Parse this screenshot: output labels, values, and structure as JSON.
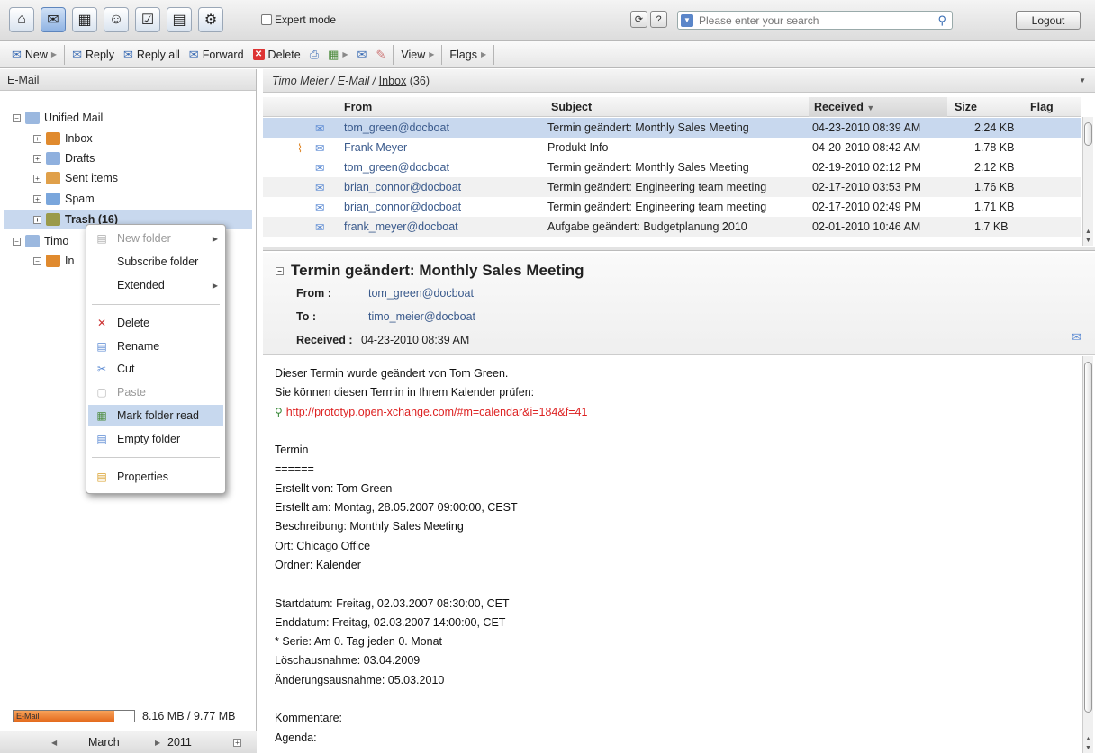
{
  "topbar": {
    "modules": [
      "home-icon",
      "mail-icon",
      "calendar-icon",
      "contacts-icon",
      "tasks-icon",
      "infostore-icon",
      "settings-icon"
    ],
    "expert_mode_label": "Expert mode",
    "search_placeholder": "Please enter your search",
    "logout_label": "Logout"
  },
  "toolbar": {
    "new": "New",
    "reply": "Reply",
    "reply_all": "Reply all",
    "forward": "Forward",
    "delete": "Delete",
    "view": "View",
    "flags": "Flags"
  },
  "left": {
    "header": "E-Mail",
    "tree": {
      "unified_mail": "Unified Mail",
      "inbox": "Inbox",
      "drafts": "Drafts",
      "sent": "Sent items",
      "spam": "Spam",
      "trash": "Trash (16)",
      "timo": "Timo",
      "timo_inbox": "In"
    },
    "quota": {
      "label": "E-Mail",
      "text": "8.16 MB / 9.77 MB",
      "fraction": 0.835
    },
    "calendar": {
      "month": "March",
      "year": "2011"
    }
  },
  "context_menu": {
    "new_folder": "New folder",
    "subscribe_folder": "Subscribe folder",
    "extended": "Extended",
    "delete": "Delete",
    "rename": "Rename",
    "cut": "Cut",
    "paste": "Paste",
    "mark_folder_read": "Mark folder read",
    "empty_folder": "Empty folder",
    "properties": "Properties"
  },
  "breadcrumb": {
    "user": "Timo Meier",
    "section": "E-Mail",
    "folder": "Inbox",
    "count": "(36)"
  },
  "message_list": {
    "headers": {
      "from": "From",
      "subject": "Subject",
      "received": "Received",
      "size": "Size",
      "flag": "Flag"
    },
    "rows": [
      {
        "from": "tom_green@docboat",
        "subject": "Termin geändert: Monthly Sales Meeting",
        "received": "04-23-2010 08:39 AM",
        "size": "2.24 KB"
      },
      {
        "from": "Frank Meyer",
        "subject": "Produkt Info",
        "received": "04-20-2010 08:42 AM",
        "size": "1.78 KB"
      },
      {
        "from": "tom_green@docboat",
        "subject": "Termin geändert: Monthly Sales Meeting",
        "received": "02-19-2010 02:12 PM",
        "size": "2.12 KB"
      },
      {
        "from": "brian_connor@docboat",
        "subject": "Termin geändert: Engineering team meeting",
        "received": "02-17-2010 03:53 PM",
        "size": "1.76 KB"
      },
      {
        "from": "brian_connor@docboat",
        "subject": "Termin geändert: Engineering team meeting",
        "received": "02-17-2010 02:49 PM",
        "size": "1.71 KB"
      },
      {
        "from": "frank_meyer@docboat",
        "subject": "Aufgabe geändert: Budgetplanung 2010",
        "received": "02-01-2010 10:46 AM",
        "size": "1.7 KB"
      }
    ]
  },
  "preview": {
    "subject": "Termin geändert: Monthly Sales Meeting",
    "from_label": "From :",
    "from_value": "tom_green@docboat",
    "to_label": "To :",
    "to_value": "timo_meier@docboat",
    "received_label": "Received :",
    "received_value": "04-23-2010 08:39 AM",
    "body": {
      "l1": "Dieser Termin wurde geändert von Tom Green.",
      "l2": "Sie können diesen Termin in Ihrem Kalender prüfen:",
      "link": "http://prototyp.open-xchange.com/#m=calendar&i=184&f=41",
      "l4": "Termin",
      "l5": "======",
      "l6": "Erstellt von:  Tom Green",
      "l7": "Erstellt am: Montag, 28.05.2007 09:00:00, CEST",
      "l8": "Beschreibung: Monthly Sales Meeting",
      "l9": "Ort: Chicago Office",
      "l10": "Ordner: Kalender",
      "l11": "Startdatum: Freitag, 02.03.2007 08:30:00, CET",
      "l12": "Enddatum: Freitag, 02.03.2007 14:00:00, CET",
      "l13": "* Serie: Am 0. Tag jeden 0. Monat",
      "l14": "Löschausnahme: 03.04.2009",
      "l15": "Änderungsausnahme: 05.03.2010",
      "l16": "Kommentare:",
      "l17": "Agenda:"
    }
  }
}
